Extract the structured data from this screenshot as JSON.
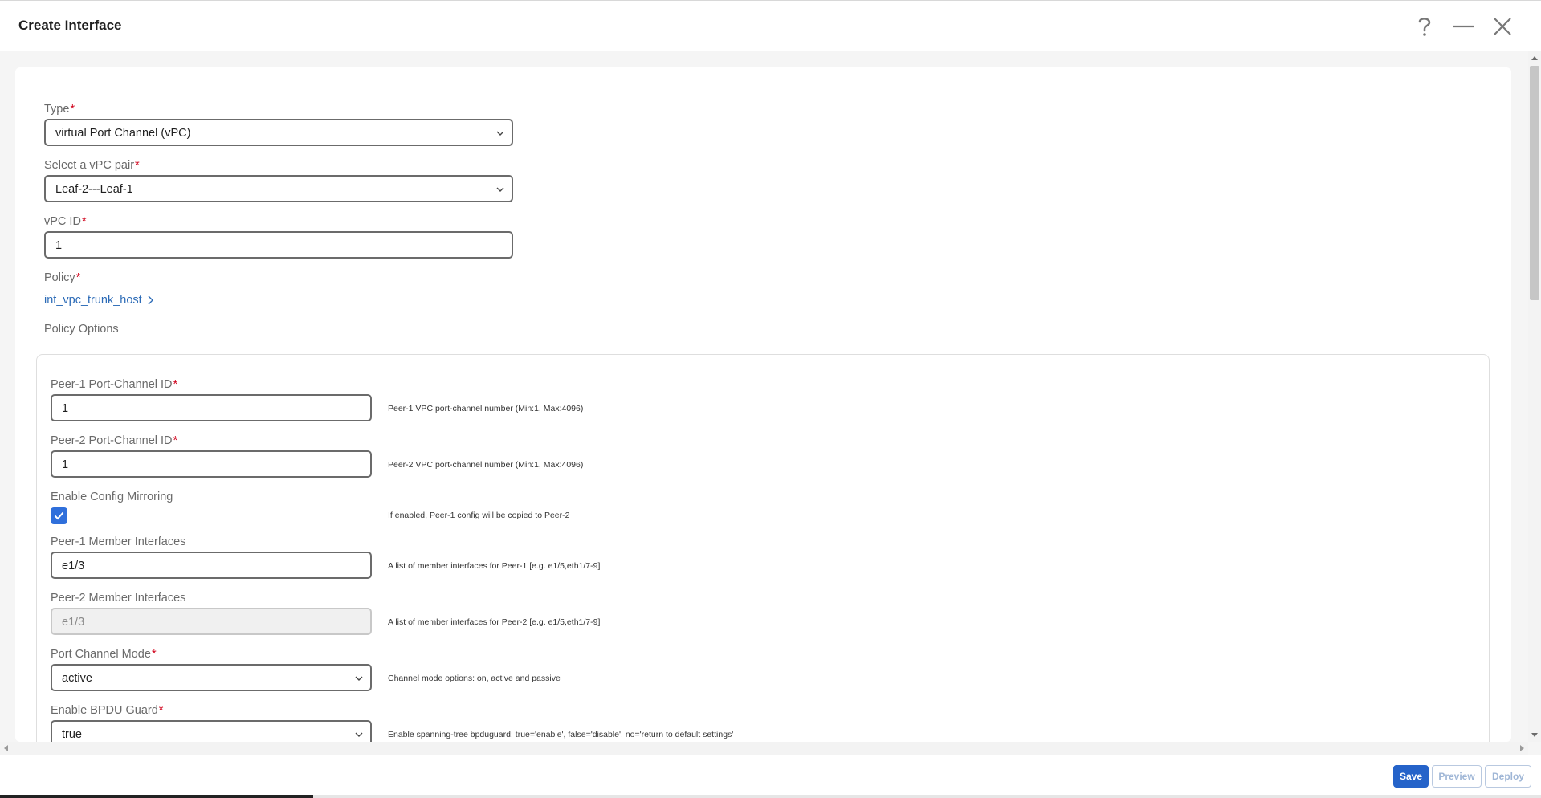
{
  "header": {
    "title": "Create Interface",
    "help_icon": "question-mark-icon",
    "minimize_icon": "minimize-icon",
    "close_icon": "close-icon"
  },
  "form": {
    "type": {
      "label": "Type",
      "value": "virtual Port Channel (vPC)"
    },
    "vpc_pair": {
      "label": "Select a vPC pair",
      "value": "Leaf-2---Leaf-1"
    },
    "vpc_id": {
      "label": "vPC ID",
      "value": "1"
    },
    "policy": {
      "label": "Policy",
      "value": "int_vpc_trunk_host"
    },
    "policy_options_label": "Policy Options",
    "required_mark": "*"
  },
  "options": {
    "peer1_pc_id": {
      "label": "Peer-1 Port-Channel ID",
      "value": "1",
      "help": "Peer-1 VPC port-channel number (Min:1, Max:4096)"
    },
    "peer2_pc_id": {
      "label": "Peer-2 Port-Channel ID",
      "value": "1",
      "help": "Peer-2 VPC port-channel number (Min:1, Max:4096)"
    },
    "config_mirroring": {
      "label": "Enable Config Mirroring",
      "checked": true,
      "help": "If enabled, Peer-1 config will be copied to Peer-2"
    },
    "peer1_members": {
      "label": "Peer-1 Member Interfaces",
      "value": "e1/3",
      "help": "A list of member interfaces for Peer-1 [e.g. e1/5,eth1/7-9]"
    },
    "peer2_members": {
      "label": "Peer-2 Member Interfaces",
      "value": "e1/3",
      "help": "A list of member interfaces for Peer-2 [e.g. e1/5,eth1/7-9]"
    },
    "pc_mode": {
      "label": "Port Channel Mode",
      "value": "active",
      "help": "Channel mode options: on, active and passive"
    },
    "bpdu_guard": {
      "label": "Enable BPDU Guard",
      "value": "true",
      "help": "Enable spanning-tree bpduguard: true='enable', false='disable', no='return to default settings'"
    }
  },
  "footer": {
    "save_label": "Save",
    "preview_label": "Preview",
    "deploy_label": "Deploy"
  },
  "colors": {
    "accent": "#2563c9",
    "link": "#2c6bb7",
    "required": "#d0021b"
  }
}
